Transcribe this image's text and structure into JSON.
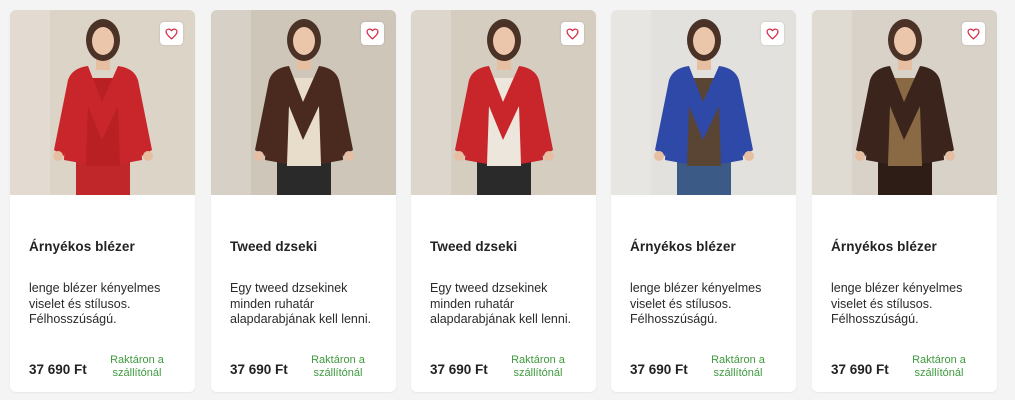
{
  "colors": {
    "favorite_icon": "#d9304a",
    "stock_text": "#3f9a3f",
    "price_text": "#222222"
  },
  "products": [
    {
      "name": "Árnyékos blézer",
      "description": "lenge blézer kényelmes viselet és stílusos. Félhosszúságú.",
      "price": "37 690 Ft",
      "stock": "Raktáron a szállítónál",
      "favorite_icon": "heart-icon",
      "jacket_color": "#c8262a",
      "inner_color": "#b82024",
      "pants_color": "#c0272b",
      "background": "#ddd4c8"
    },
    {
      "name": "Tweed dzseki",
      "description": "Egy tweed dzsekinek minden ruhatár alapdarabjának kell lenni.",
      "price": "37 690 Ft",
      "stock": "Raktáron a szállítónál",
      "favorite_icon": "heart-icon",
      "jacket_color": "#4a2a1f",
      "inner_color": "#e8dccb",
      "pants_color": "#2a2a2a",
      "background": "#cfc6ba"
    },
    {
      "name": "Tweed dzseki",
      "description": "Egy tweed dzsekinek minden ruhatár alapdarabjának kell lenni.",
      "price": "37 690 Ft",
      "stock": "Raktáron a szállítónál",
      "favorite_icon": "heart-icon",
      "jacket_color": "#c8262a",
      "inner_color": "#ece6dc",
      "pants_color": "#2a2a2a",
      "background": "#d6cdc1"
    },
    {
      "name": "Árnyékos blézer",
      "description": "lenge blézer kényelmes viselet és stílusos. Félhosszúságú.",
      "price": "37 690 Ft",
      "stock": "Raktáron a szállítónál",
      "favorite_icon": "heart-icon",
      "jacket_color": "#2f49a8",
      "inner_color": "#5a4535",
      "pants_color": "#3b5a86",
      "background": "#e3e1dd"
    },
    {
      "name": "Árnyékos blézer",
      "description": "lenge blézer kényelmes viselet és stílusos. Félhosszúságú.",
      "price": "37 690 Ft",
      "stock": "Raktáron a szállítónál",
      "favorite_icon": "heart-icon",
      "jacket_color": "#3a241c",
      "inner_color": "#8a6a45",
      "pants_color": "#2e1c16",
      "background": "#d8d2c8"
    }
  ]
}
